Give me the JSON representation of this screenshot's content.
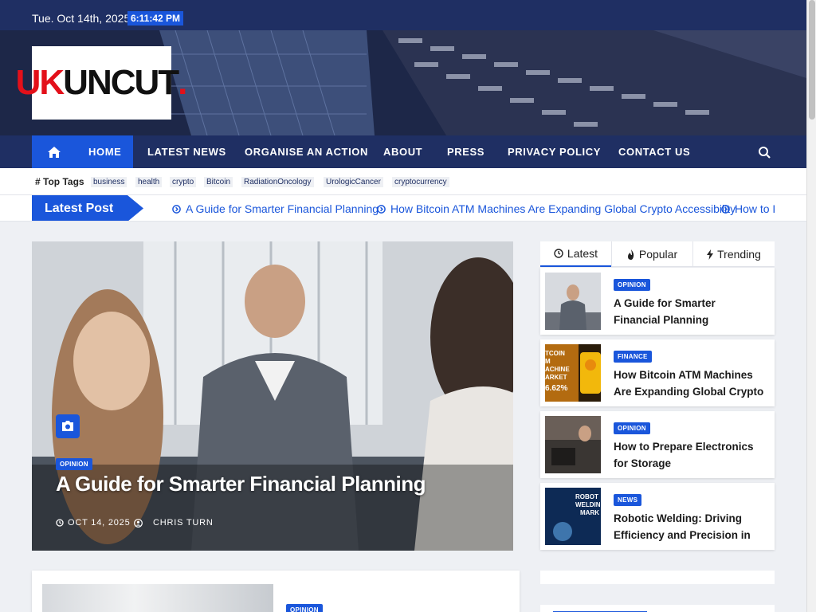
{
  "topbar": {
    "date": "Tue. Oct 14th, 2025",
    "time": "6:11:42 PM"
  },
  "logo": {
    "part1": "UK",
    "part2": "UNCUT",
    "part3": "."
  },
  "nav": {
    "items": [
      "HOME",
      "LATEST NEWS",
      "ORGANISE AN ACTION",
      "ABOUT",
      "PRESS",
      "PRIVACY POLICY",
      "CONTACT US"
    ],
    "active": "HOME",
    "home_icon": "home-icon",
    "search_icon": "search-icon"
  },
  "tags": {
    "label": "Top Tags",
    "items": [
      "business",
      "health",
      "crypto",
      "Bitcoin",
      "RadiationOncology",
      "UrologicCancer",
      "cryptocurrency"
    ]
  },
  "ticker": {
    "label": "Latest Post",
    "items": [
      "A Guide for Smarter Financial Planning",
      "How Bitcoin ATM Machines Are Expanding Global Crypto Accessibility",
      "How to P"
    ]
  },
  "hero": {
    "category": "OPINION",
    "title": "A Guide for Smarter Financial Planning",
    "date": "OCT 14, 2025",
    "author": "CHRIS TURN",
    "camera_icon": "camera-icon"
  },
  "sidebar": {
    "tabs": [
      "Latest",
      "Popular",
      "Trending"
    ],
    "active_tab": "Latest",
    "posts": [
      {
        "category": "OPINION",
        "title": "A Guide for Smarter Financial Planning"
      },
      {
        "category": "FINANCE",
        "title": "How Bitcoin ATM Machines Are Expanding Global Crypto"
      },
      {
        "category": "OPINION",
        "title": "How to Prepare Electronics for Storage"
      },
      {
        "category": "NEWS",
        "title": "Robotic Welding: Driving Efficiency and Precision in"
      }
    ],
    "thumb_text": {
      "bitcoin": "TCOIN\nM\nACHINE\nARKET\n6.62%",
      "robot": "ROBOT\nWELDIN\nMARK"
    }
  },
  "lower": {
    "category": "OPINION"
  },
  "colors": {
    "navy": "#1f2f63",
    "accent": "#1a56db",
    "logo_red": "#e3101a"
  }
}
